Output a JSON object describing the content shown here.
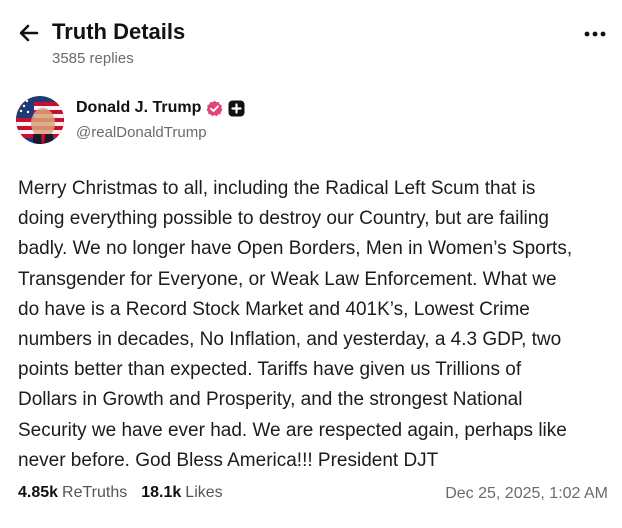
{
  "header": {
    "title": "Truth Details",
    "replies": "3585 replies",
    "back_icon": "arrow-left-icon",
    "more_icon": "more-dots-icon"
  },
  "author": {
    "name": "Donald J. Trump",
    "handle": "@realDonaldTrump",
    "verified_color": "#e0457b"
  },
  "post": {
    "text": "Merry Christmas to all, including the Radical  Left Scum that is\ndoing everything possible to destroy our Country, but are failing\nbadly. We no longer have Open Borders, Men in Women’s Sports,\nTransgender for Everyone, or Weak Law Enforcement. What we\ndo have is a Record Stock Market and 401K’s, Lowest Crime\nnumbers in decades, No Inflation, and yesterday, a 4.3 GDP, two\npoints better than expected. Tariffs have given us Trillions of\nDollars in Growth and Prosperity, and the strongest National\nSecurity we have ever had. We are respected again, perhaps like\nnever before. God Bless America!!! President DJT"
  },
  "stats": {
    "retruths_count": "4.85k",
    "retruths_label": "ReTruths",
    "likes_count": "18.1k",
    "likes_label": "Likes",
    "timestamp": "Dec 25, 2025, 1:02 AM"
  }
}
